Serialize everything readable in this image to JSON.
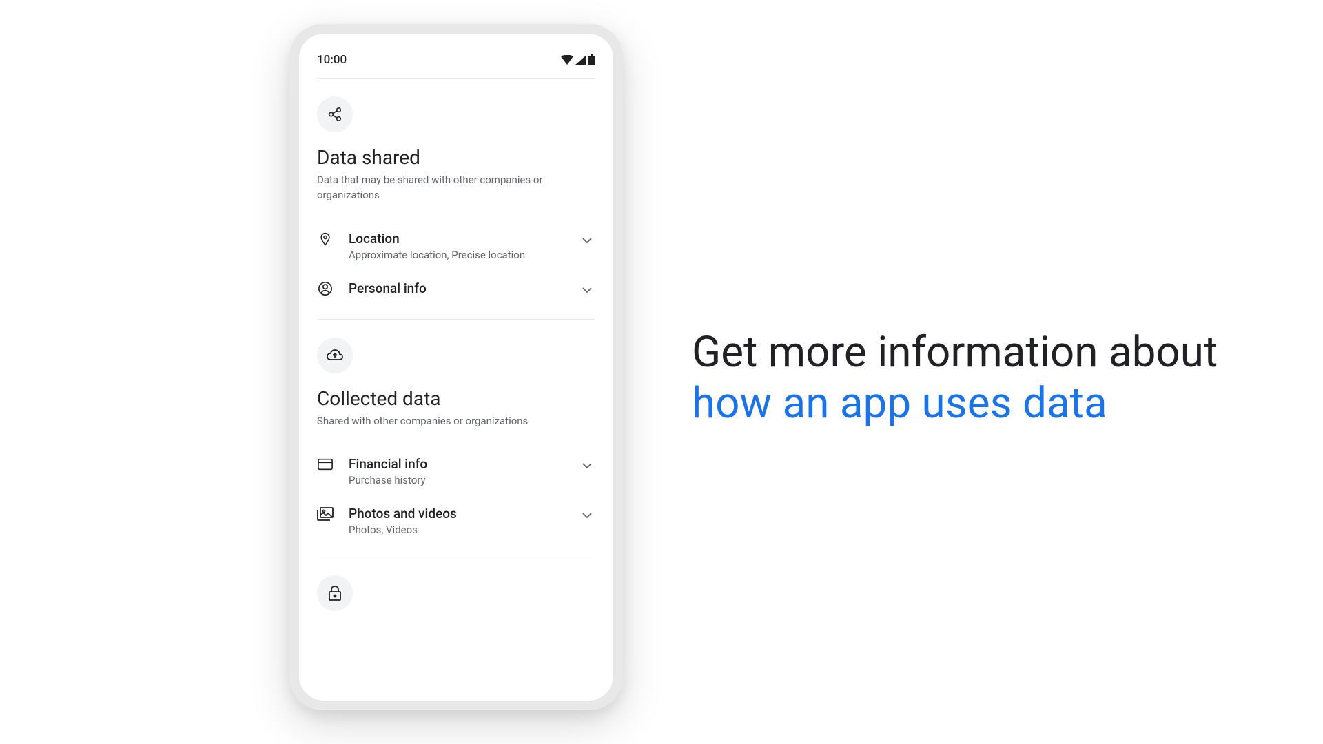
{
  "statusBar": {
    "time": "10:00"
  },
  "sections": {
    "dataShared": {
      "title": "Data shared",
      "subtitle": "Data that may be shared with other companies or organizations",
      "items": [
        {
          "title": "Location",
          "subtitle": "Approximate location, Precise location"
        },
        {
          "title": "Personal info",
          "subtitle": ""
        }
      ]
    },
    "collectedData": {
      "title": "Collected data",
      "subtitle": "Shared with other companies or organizations",
      "items": [
        {
          "title": "Financial info",
          "subtitle": "Purchase history"
        },
        {
          "title": "Photos and videos",
          "subtitle": "Photos, Videos"
        }
      ]
    }
  },
  "headline": {
    "line1": "Get more information about",
    "line2": "how an app uses data"
  }
}
